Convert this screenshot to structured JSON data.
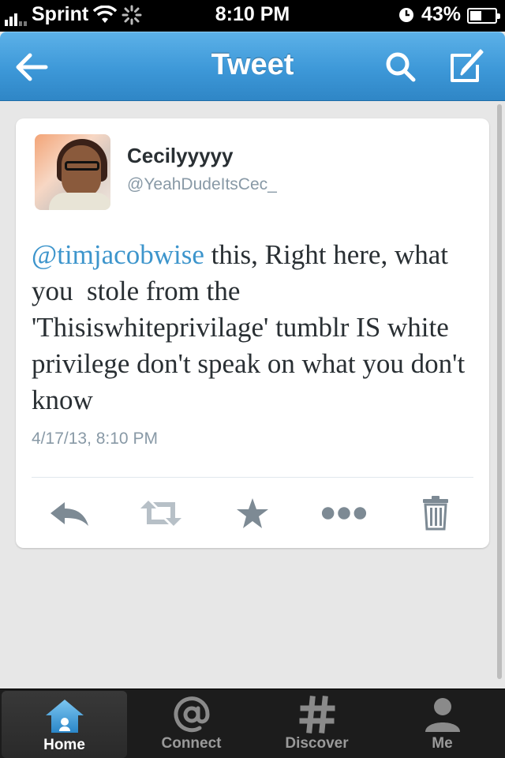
{
  "status_bar": {
    "carrier": "Sprint",
    "time": "8:10 PM",
    "battery": "43%",
    "battery_level": 0.43,
    "signal_bars_filled": 3,
    "signal_bars_total": 5
  },
  "nav": {
    "title": "Tweet",
    "back_icon": "back-arrow-icon",
    "search_icon": "search-icon",
    "compose_icon": "compose-icon"
  },
  "tweet": {
    "display_name": "Cecilyyyyy",
    "handle": "@YeahDudeItsCec_",
    "mention": "@timjacobwise",
    "text": " this, Right here, what you  stole from the 'Thisiswhiteprivilage' tumblr IS white privilege don't speak on what you don't know",
    "timestamp": "4/17/13, 8:10 PM",
    "actions": [
      {
        "name": "reply",
        "icon": "reply-icon"
      },
      {
        "name": "retweet",
        "icon": "retweet-icon"
      },
      {
        "name": "favorite",
        "icon": "star-icon"
      },
      {
        "name": "more",
        "icon": "more-icon"
      },
      {
        "name": "delete",
        "icon": "trash-icon"
      }
    ]
  },
  "tab_bar": {
    "tabs": [
      {
        "label": "Home",
        "icon": "home-icon",
        "active": true
      },
      {
        "label": "Connect",
        "icon": "at-icon",
        "active": false
      },
      {
        "label": "Discover",
        "icon": "hashtag-icon",
        "active": false
      },
      {
        "label": "Me",
        "icon": "person-icon",
        "active": false
      }
    ]
  },
  "colors": {
    "nav_blue": "#3d98d8",
    "mention_blue": "#3d95cc",
    "secondary_text": "#8899a6",
    "icon_gray": "#7d8a94"
  }
}
